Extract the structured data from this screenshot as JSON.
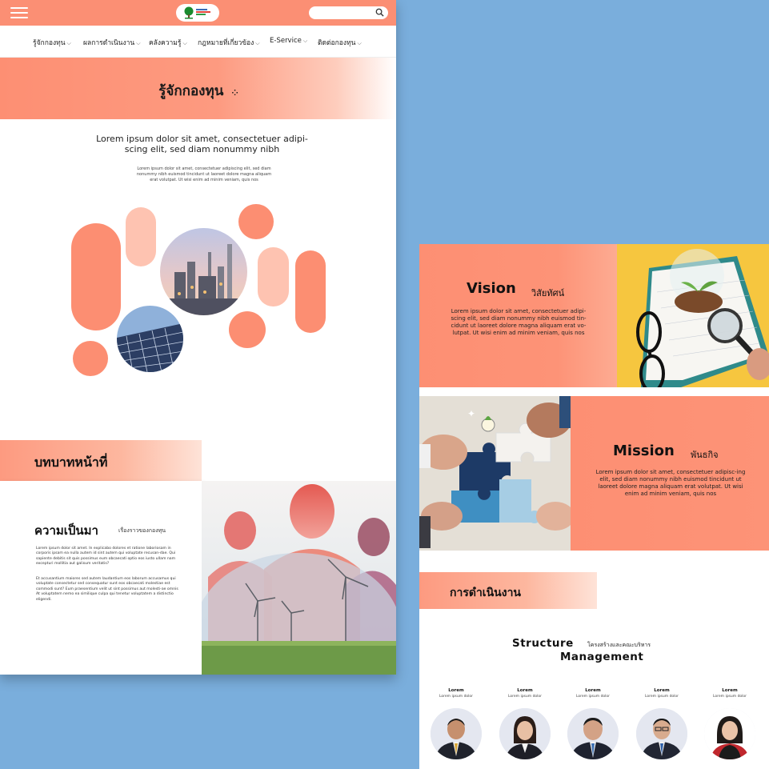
{
  "left_page": {
    "nav": {
      "items": [
        {
          "label": "รู้จักกองทุน"
        },
        {
          "label": "ผลการดำเนินงาน"
        },
        {
          "label": "คลังความรู้"
        },
        {
          "label": "กฎหมายที่เกี่ยวข้อง"
        },
        {
          "label": "E-Service"
        },
        {
          "label": "ติดต่อกองทุน"
        }
      ],
      "chevron": "⌵"
    },
    "hero": {
      "title": "รู้จักกองทุน"
    },
    "intro": {
      "heading": "Lorem ipsum dolor sit amet, consectetuer adipi-scing elit, sed diam nonummy nibh",
      "body": "Lorem ipsum dolor sit amet, consectetuer adipiscing elit, sed diam nonummy nibh euismod tincidunt ut laoreet dolore magna aliquam erat volutpat. Ut wisi enim ad minim veniam, quis nos"
    },
    "role": {
      "title": "บทบาทหน้าที่"
    },
    "history": {
      "title": "ความเป็นมา",
      "subtitle": "เรื่องราวของกองทุน",
      "p1": "Lorem ipsum dolor sit amet. In explicabo dolores et ratione laboriosam in corporis ipsam ea nulla autem id sint autem qui voluptate recusan-dae. Qui sapiente debitis sit quis possimus eum obcaecati optio eos iusto ullam nam excepturi mollitia aut galisum veritatis?",
      "p2": "Et accusantium maiores sed autem laudantium eos laborum accusamus qui voluptate consectetur sed consequatur sunt eos obcaecati molestiae est commodi sunt? Eum praesentium velit ut sint possimus aut molesti-ae omnis At voluptatem nemo ea similique culpa qui tenetur voluptatem a distinctio eligendi."
    },
    "colors": {
      "accent": "#fc8e72",
      "accent_light": "#fec3b1",
      "background": "#7aaedc"
    }
  },
  "right_page": {
    "vision": {
      "title": "Vision",
      "subtitle": "วิสัยทัศน์",
      "body": "Lorem ipsum dolor sit amet, consectetuer adipi-scing elit, sed diam nonummy nibh euismod tin-cidunt ut laoreet dolore magna aliquam erat vo-lutpat. Ut wisi enim ad minim veniam, quis nos"
    },
    "mission": {
      "title": "Mission",
      "subtitle": "พันธกิจ",
      "body": "Lorem ipsum dolor sit amet, consectetuer adipisc-ing elit, sed diam nonummy nibh euismod tincidunt ut laoreet dolore magna aliquam erat volutpat. Ut wisi enim ad minim veniam, quis nos"
    },
    "operations": {
      "title": "การดำเนินงาน"
    },
    "structure": {
      "title_line1": "Structure",
      "subtitle": "โครงสร้างและคณะบริหาร",
      "title_line2": "Management",
      "members": [
        {
          "role": "Lorem",
          "name": "Lorem ipsum dolor"
        },
        {
          "role": "Lorem",
          "name": "Lorem ipsum dolor"
        },
        {
          "role": "Lorem",
          "name": "Lorem ipsum dolor"
        },
        {
          "role": "Lorem",
          "name": "Lorem ipsum dolor"
        },
        {
          "role": "Lorem",
          "name": "Lorem ipsum dolor"
        }
      ]
    }
  }
}
